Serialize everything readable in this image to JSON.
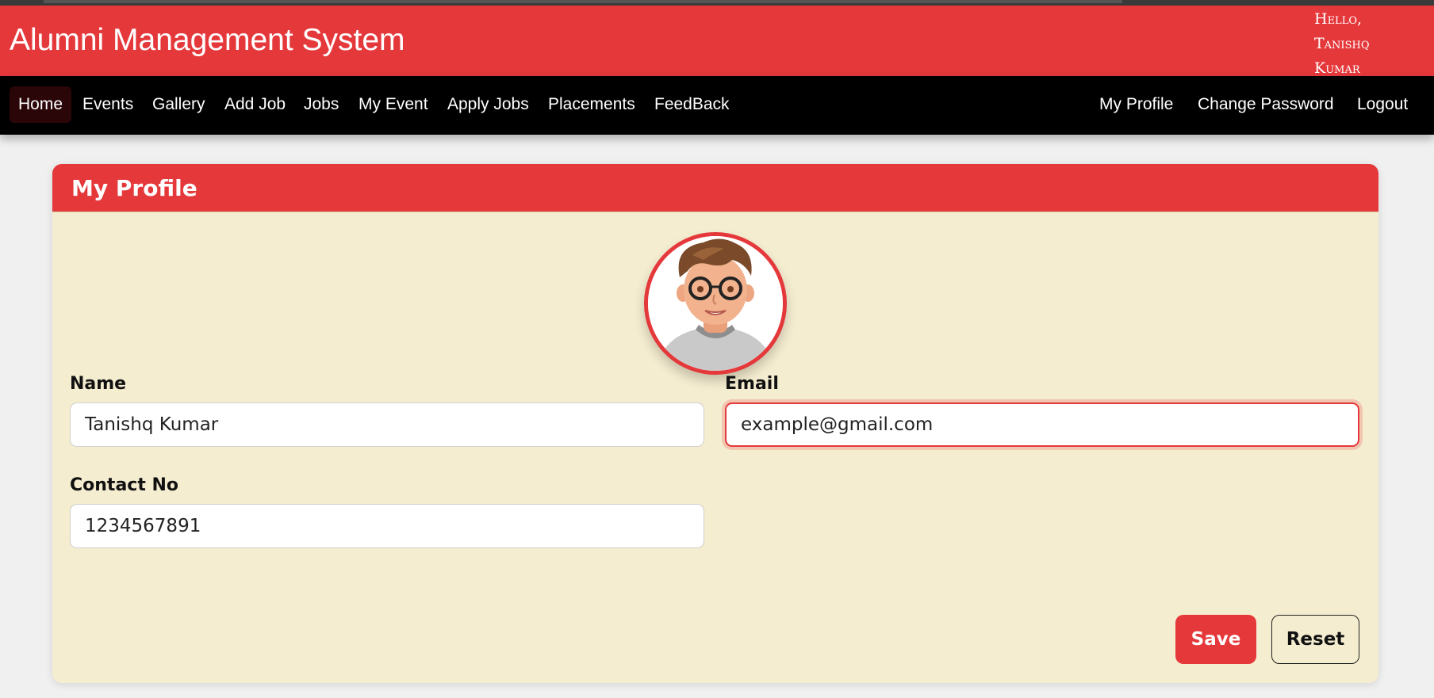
{
  "header": {
    "title": "Alumni Management System",
    "greeting_line1": "Hello,",
    "greeting_line2": "Tanishq",
    "greeting_line3": "Kumar"
  },
  "nav": {
    "left": [
      "Home",
      "Events",
      "Gallery",
      "Add Job",
      "Jobs",
      "My Event",
      "Apply Jobs",
      "Placements",
      "FeedBack"
    ],
    "right": [
      "My Profile",
      "Change Password",
      "Logout"
    ],
    "active": "Home"
  },
  "profile": {
    "title": "My Profile",
    "avatar_icon": "cartoon-avatar-with-glasses",
    "name_label": "Name",
    "name_value": "Tanishq Kumar",
    "email_label": "Email",
    "email_value": "example@gmail.com",
    "contact_label": "Contact No",
    "contact_value": "1234567891",
    "save_label": "Save",
    "reset_label": "Reset"
  },
  "colors": {
    "accent": "#e5383b",
    "card_bg": "#f5edd0",
    "nav_bg": "#000000"
  }
}
